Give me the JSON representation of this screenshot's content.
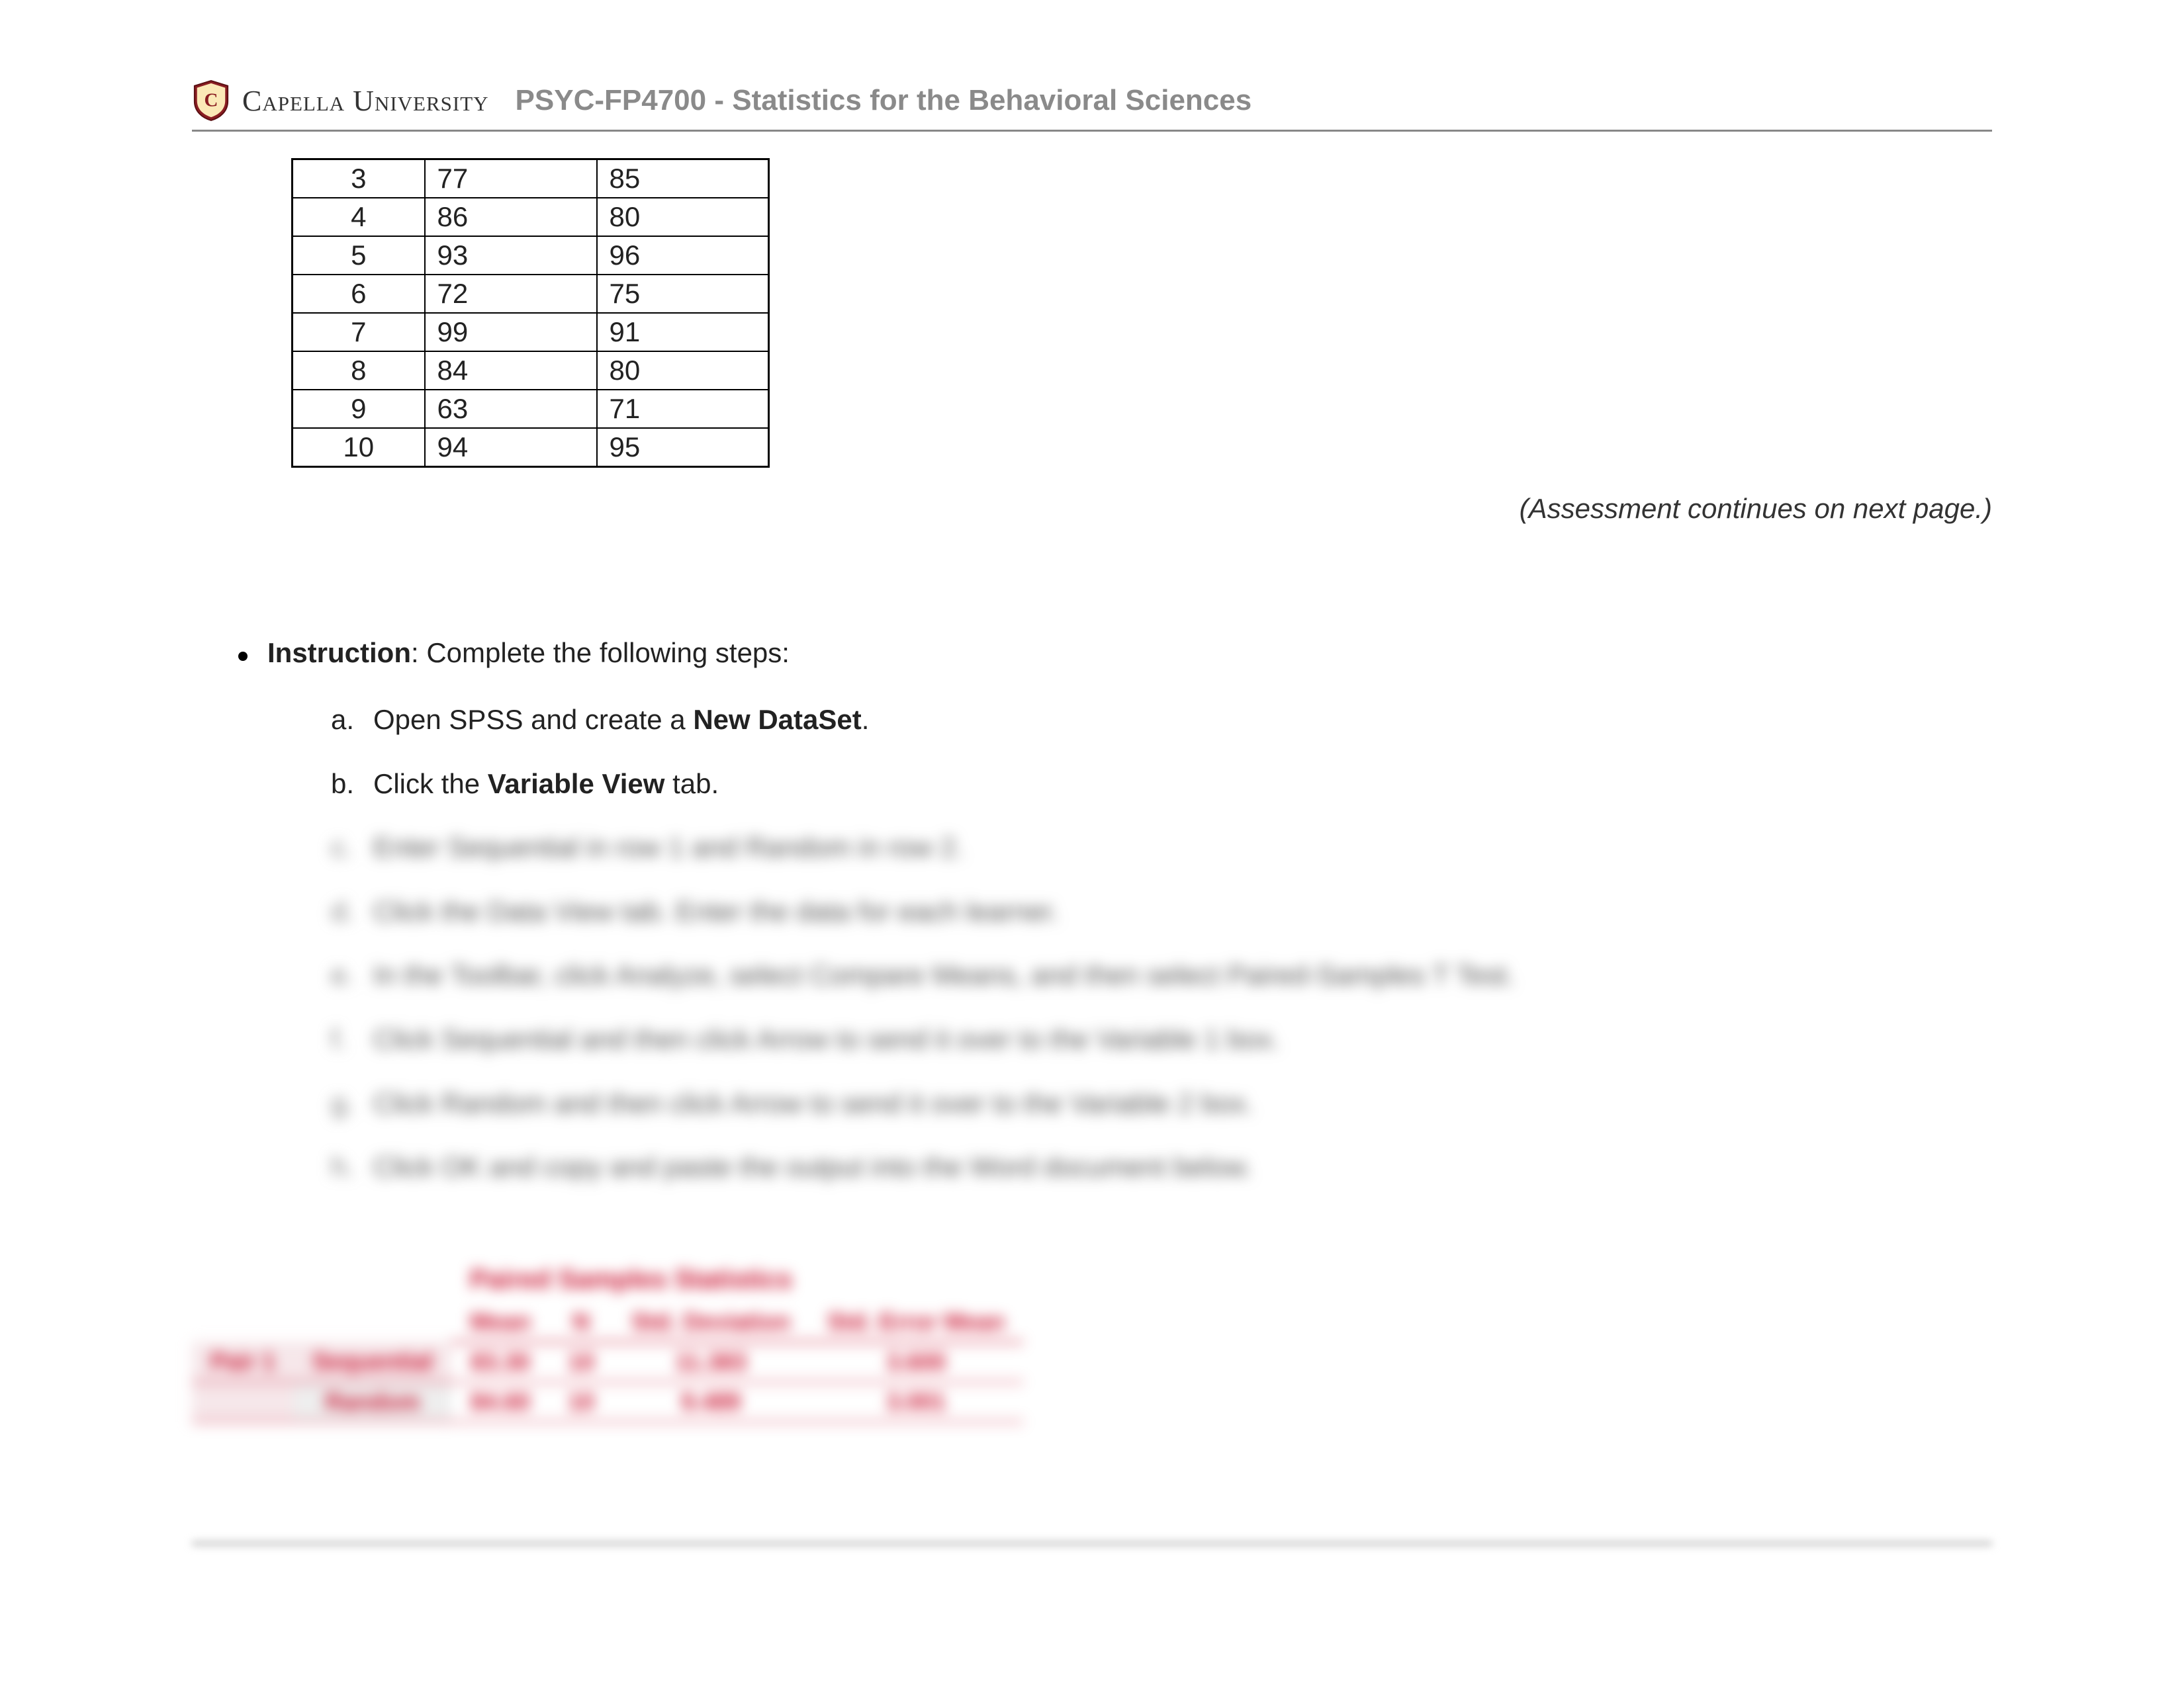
{
  "header": {
    "university_name": "Capella University",
    "course_title": "PSYC-FP4700 - Statistics for the Behavioral Sciences"
  },
  "data_table": {
    "rows": [
      {
        "n": "3",
        "a": "77",
        "b": "85"
      },
      {
        "n": "4",
        "a": "86",
        "b": "80"
      },
      {
        "n": "5",
        "a": "93",
        "b": "96"
      },
      {
        "n": "6",
        "a": "72",
        "b": "75"
      },
      {
        "n": "7",
        "a": "99",
        "b": "91"
      },
      {
        "n": "8",
        "a": "84",
        "b": "80"
      },
      {
        "n": "9",
        "a": "63",
        "b": "71"
      },
      {
        "n": "10",
        "a": "94",
        "b": "95"
      }
    ]
  },
  "page_note": "(Assessment continues on next page.)",
  "instructions": {
    "label": "Instruction",
    "lead_text": ": Complete the following steps:",
    "steps": {
      "a": {
        "letter": "a.",
        "pre": "Open SPSS and create a ",
        "bold": "New DataSet",
        "post": "."
      },
      "b": {
        "letter": "b.",
        "pre": "Click the ",
        "bold": "Variable View",
        "post": " tab."
      },
      "c": {
        "letter": "c.",
        "text": "Enter Sequential in row 1 and Random in row 2."
      },
      "d": {
        "letter": "d.",
        "text": "Click the Data View tab. Enter the data for each learner."
      },
      "e": {
        "letter": "e.",
        "text": "In the Toolbar, click Analyze, select Compare Means, and then select Paired-Samples T Test."
      },
      "f": {
        "letter": "f.",
        "text": "Click Sequential and then click Arrow to send it over to the Variable 1 box."
      },
      "g": {
        "letter": "g.",
        "text": "Click Random and then click Arrow to send it over to the Variable 2 box."
      },
      "h": {
        "letter": "h.",
        "text": "Click OK and copy and paste the output into the Word document below."
      }
    }
  },
  "paired_stats": {
    "title": "Paired Samples Statistics",
    "headers": {
      "mean": "Mean",
      "n": "N",
      "sd": "Std. Deviation",
      "se": "Std. Error Mean"
    },
    "pair_label": "Pair 1",
    "rows": [
      {
        "name": "Sequential",
        "mean": "83.30",
        "n": "10",
        "sd": "11.383",
        "se": "3.600"
      },
      {
        "name": "Random",
        "mean": "84.60",
        "n": "10",
        "sd": "9.489",
        "se": "3.001"
      }
    ]
  }
}
